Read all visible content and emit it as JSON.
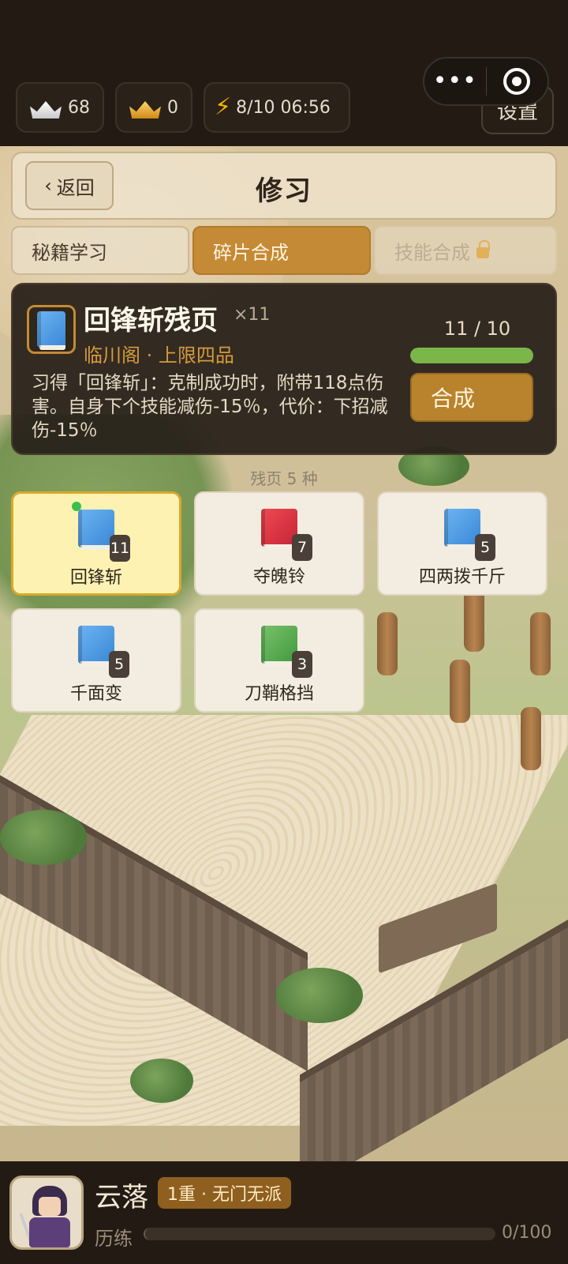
{
  "topbar": {
    "silver": "68",
    "gold": "0",
    "energy": "8/10 06:56",
    "settings_label": "设置",
    "capsule_more_icon": "more-dots-icon",
    "capsule_close_icon": "target-icon"
  },
  "header": {
    "back_label": "返回",
    "title": "修习"
  },
  "tabs": [
    {
      "label": "秘籍学习",
      "state": "inactive"
    },
    {
      "label": "碎片合成",
      "state": "active"
    },
    {
      "label": "技能合成",
      "state": "locked"
    }
  ],
  "detail": {
    "name": "回锋斩残页",
    "qty": "×11",
    "source": "临川阁 · 上限四品",
    "description": "习得「回锋斩」：克制成功时，附带118点伤害。自身下个技能减伤-15％，代价：下招减伤-15％",
    "progress_text": "11 / 10",
    "progress_fraction": 1.0,
    "craft_label": "合成",
    "book_color": "blue"
  },
  "count_label": "残页 5 种",
  "fragments": [
    {
      "name": "回锋斩",
      "count": "11",
      "color": "blue",
      "selected": true,
      "new": true
    },
    {
      "name": "夺魄铃",
      "count": "7",
      "color": "red",
      "selected": false,
      "new": false
    },
    {
      "name": "四两拨千斤",
      "count": "5",
      "color": "blue",
      "selected": false,
      "new": false
    },
    {
      "name": "千面变",
      "count": "5",
      "color": "blue",
      "selected": false,
      "new": false
    },
    {
      "name": "刀鞘格挡",
      "count": "3",
      "color": "green",
      "selected": false,
      "new": false
    }
  ],
  "player": {
    "name": "云落",
    "rank": "1重 · 无门无派",
    "exp_label": "历练",
    "exp_text": "0/100",
    "exp_fraction": 0
  }
}
